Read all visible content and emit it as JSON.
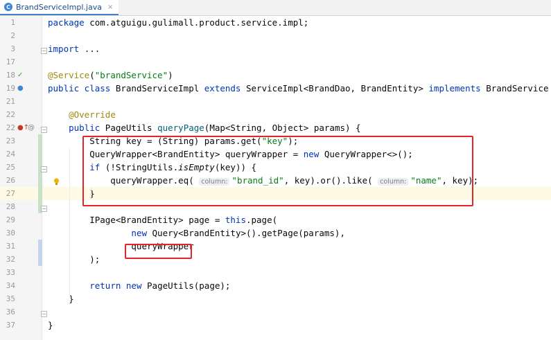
{
  "tab": {
    "icon_letter": "C",
    "label": "BrandServiceImpl.java",
    "close": "×"
  },
  "lines": [
    {
      "n": "1",
      "t": [
        {
          "s": "package ",
          "c": "kw"
        },
        {
          "s": "com.atguigu.gulimall.product.service.impl;"
        }
      ]
    },
    {
      "n": "2",
      "t": []
    },
    {
      "n": "3",
      "t": [
        {
          "s": "import ",
          "c": "kw"
        },
        {
          "s": "..."
        }
      ]
    },
    {
      "n": "17",
      "t": []
    },
    {
      "n": "18",
      "t": [
        {
          "s": "@Service",
          "c": "ann"
        },
        {
          "s": "("
        },
        {
          "s": "\"brandService\"",
          "c": "str"
        },
        {
          "s": ")"
        }
      ]
    },
    {
      "n": "19",
      "t": [
        {
          "s": "public class ",
          "c": "kw"
        },
        {
          "s": "BrandServiceImpl "
        },
        {
          "s": "extends ",
          "c": "kw"
        },
        {
          "s": "ServiceImpl<BrandDao, BrandEntity> "
        },
        {
          "s": "implements ",
          "c": "kw"
        },
        {
          "s": "BrandService {"
        }
      ]
    },
    {
      "n": "21",
      "t": []
    },
    {
      "n": "22",
      "t": [
        {
          "s": "    "
        },
        {
          "s": "@Override",
          "c": "ann"
        }
      ]
    },
    {
      "n": "22",
      "t": [
        {
          "s": "    "
        },
        {
          "s": "public ",
          "c": "kw"
        },
        {
          "s": "PageUtils "
        },
        {
          "s": "queryPage",
          "c": "mth"
        },
        {
          "s": "(Map<String, Object> params) {"
        }
      ]
    },
    {
      "n": "23",
      "t": [
        {
          "s": "        String key = (String) params.get("
        },
        {
          "s": "\"key\"",
          "c": "str"
        },
        {
          "s": ");"
        }
      ]
    },
    {
      "n": "24",
      "t": [
        {
          "s": "        QueryWrapper<BrandEntity> queryWrapper = "
        },
        {
          "s": "new ",
          "c": "kw"
        },
        {
          "s": "QueryWrapper<>();"
        }
      ]
    },
    {
      "n": "25",
      "t": [
        {
          "s": "        "
        },
        {
          "s": "if ",
          "c": "kw"
        },
        {
          "s": "(!StringUtils."
        },
        {
          "s": "isEmpty",
          "c": "it"
        },
        {
          "s": "(key)) {"
        }
      ]
    },
    {
      "n": "26",
      "t": [
        {
          "s": "            queryWrapper.eq( "
        },
        {
          "s": "column:",
          "c": "hint"
        },
        {
          "s": "\"brand_id\"",
          "c": "str"
        },
        {
          "s": ", key).or().like( "
        },
        {
          "s": "column:",
          "c": "hint"
        },
        {
          "s": "\"name\"",
          "c": "str"
        },
        {
          "s": ", key);"
        }
      ]
    },
    {
      "n": "27",
      "t": [
        {
          "s": "        }"
        }
      ]
    },
    {
      "n": "28",
      "t": []
    },
    {
      "n": "29",
      "t": [
        {
          "s": "        IPage<BrandEntity> page = "
        },
        {
          "s": "this",
          "c": "kw"
        },
        {
          "s": ".page("
        }
      ]
    },
    {
      "n": "30",
      "t": [
        {
          "s": "                "
        },
        {
          "s": "new ",
          "c": "kw"
        },
        {
          "s": "Query<BrandEntity>().getPage(params),"
        }
      ]
    },
    {
      "n": "31",
      "t": [
        {
          "s": "                queryWrapper"
        }
      ]
    },
    {
      "n": "32",
      "t": [
        {
          "s": "        );"
        }
      ]
    },
    {
      "n": "33",
      "t": []
    },
    {
      "n": "34",
      "t": [
        {
          "s": "        "
        },
        {
          "s": "return new ",
          "c": "kw"
        },
        {
          "s": "PageUtils(page);"
        }
      ]
    },
    {
      "n": "35",
      "t": [
        {
          "s": "    }"
        }
      ]
    },
    {
      "n": "36",
      "t": []
    },
    {
      "n": "37",
      "t": [
        {
          "s": "}"
        }
      ]
    }
  ],
  "current_line_index": 13,
  "colors": {
    "keyword": "#0033b3",
    "string": "#067d17",
    "annotation": "#9e880d",
    "method": "#00627a",
    "highlight_box": "#e1262a"
  },
  "icons": [
    "bean-icon",
    "implements-icon",
    "override-icon",
    "lightbulb-icon",
    "fold-icon"
  ]
}
